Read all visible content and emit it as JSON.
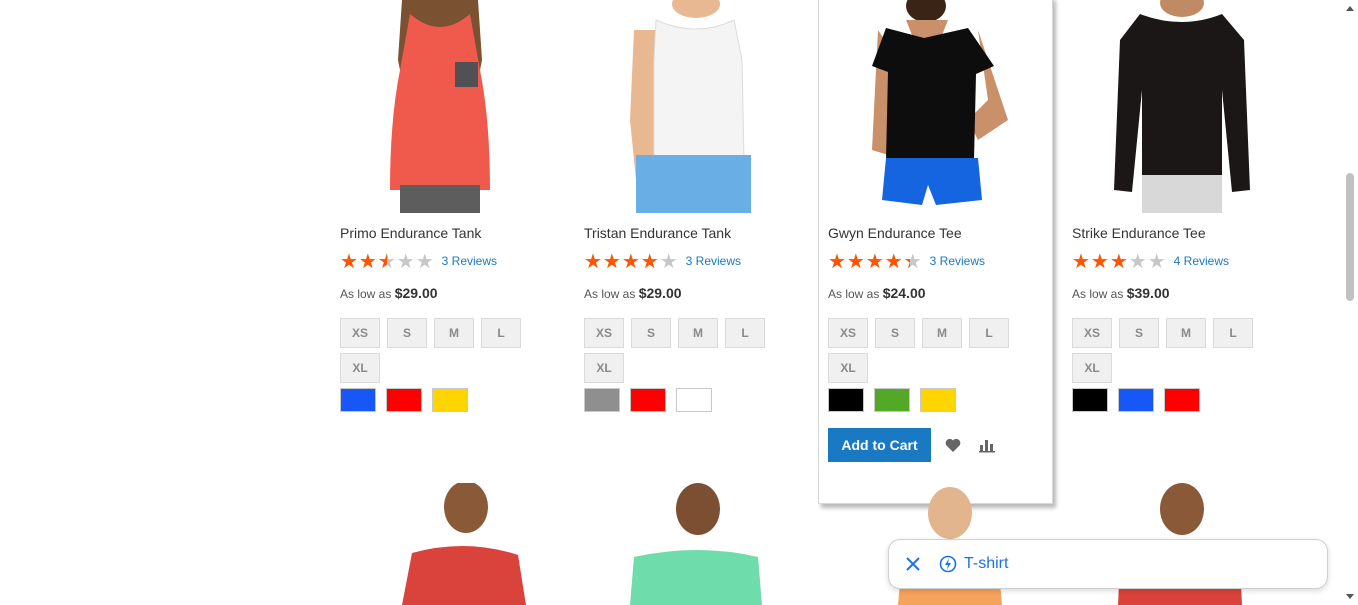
{
  "products": [
    {
      "name": "Primo Endurance Tank",
      "rating_percent": 50,
      "reviews": "3 Reviews",
      "price_prefix": "As low as",
      "price": "$29.00",
      "sizes": [
        "XS",
        "S",
        "M",
        "L",
        "XL"
      ],
      "swatches": [
        "#1857f7",
        "#ff0000",
        "#ffd500"
      ]
    },
    {
      "name": "Tristan Endurance Tank",
      "rating_percent": 80,
      "reviews": "3 Reviews",
      "price_prefix": "As low as",
      "price": "$29.00",
      "sizes": [
        "XS",
        "S",
        "M",
        "L",
        "XL"
      ],
      "swatches": [
        "#8f8f8f",
        "#ff0000",
        "#ffffff"
      ]
    },
    {
      "name": "Gwyn Endurance Tee",
      "rating_percent": 87,
      "reviews": "3 Reviews",
      "price_prefix": "As low as",
      "price": "$24.00",
      "sizes": [
        "XS",
        "S",
        "M",
        "L",
        "XL"
      ],
      "swatches": [
        "#000000",
        "#53a828",
        "#ffd500"
      ],
      "actions": {
        "add_to_cart": "Add to Cart"
      }
    },
    {
      "name": "Strike Endurance Tee",
      "rating_percent": 60,
      "reviews": "4 Reviews",
      "price_prefix": "As low as",
      "price": "$39.00",
      "sizes": [
        "XS",
        "S",
        "M",
        "L",
        "XL"
      ],
      "swatches": [
        "#000000",
        "#1857f7",
        "#ff0000"
      ]
    }
  ],
  "search_chip": {
    "text": "T-shirt"
  },
  "colors": {
    "accent": "#1979c3",
    "star": "#ff5501",
    "chip_blue": "#1a73e8"
  }
}
